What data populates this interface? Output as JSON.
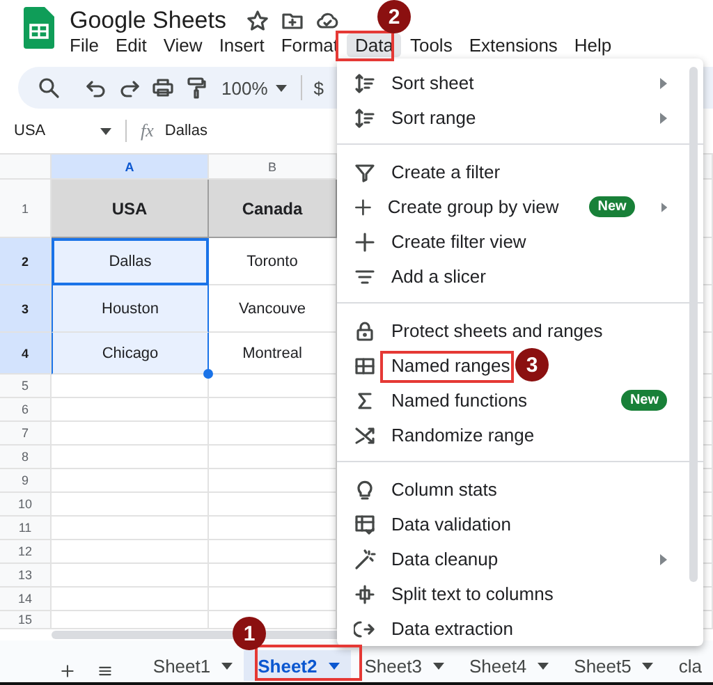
{
  "app": {
    "title": "Google Sheets"
  },
  "menu_bar": [
    {
      "label": "File",
      "selected": false
    },
    {
      "label": "Edit",
      "selected": false
    },
    {
      "label": "View",
      "selected": false
    },
    {
      "label": "Insert",
      "selected": false
    },
    {
      "label": "Format",
      "selected": false
    },
    {
      "label": "Data",
      "selected": true
    },
    {
      "label": "Tools",
      "selected": false
    },
    {
      "label": "Extensions",
      "selected": false
    },
    {
      "label": "Help",
      "selected": false
    }
  ],
  "toolbar": {
    "zoom": "100%",
    "currency": "$"
  },
  "formula_bar": {
    "name_box": "USA",
    "function_label": "fx",
    "formula": "Dallas"
  },
  "grid": {
    "columns": [
      {
        "label": "A",
        "selected": true
      },
      {
        "label": "B",
        "selected": false
      }
    ],
    "rows": [
      {
        "label": "1",
        "kind": "header",
        "selected": false,
        "cells": [
          {
            "text": "USA",
            "active": false
          },
          {
            "text": "Canada",
            "active": false
          }
        ]
      },
      {
        "label": "2",
        "kind": "data",
        "selected": true,
        "cells": [
          {
            "text": "Dallas",
            "active": true
          },
          {
            "text": "Toronto",
            "active": false
          }
        ]
      },
      {
        "label": "3",
        "kind": "data",
        "selected": true,
        "cells": [
          {
            "text": "Houston",
            "active": false
          },
          {
            "text": "Vancouve",
            "active": false
          }
        ]
      },
      {
        "label": "4",
        "kind": "data",
        "selected": true,
        "cells": [
          {
            "text": "Chicago",
            "active": false
          },
          {
            "text": "Montreal",
            "active": false
          }
        ]
      },
      {
        "label": "5",
        "kind": "empty",
        "selected": false
      },
      {
        "label": "6",
        "kind": "empty",
        "selected": false
      },
      {
        "label": "7",
        "kind": "empty",
        "selected": false
      },
      {
        "label": "8",
        "kind": "empty",
        "selected": false
      },
      {
        "label": "9",
        "kind": "empty",
        "selected": false
      },
      {
        "label": "10",
        "kind": "empty",
        "selected": false
      },
      {
        "label": "11",
        "kind": "empty",
        "selected": false
      },
      {
        "label": "12",
        "kind": "empty",
        "selected": false
      },
      {
        "label": "13",
        "kind": "empty",
        "selected": false
      },
      {
        "label": "14",
        "kind": "empty",
        "selected": false
      },
      {
        "label": "15",
        "kind": "empty",
        "selected": false
      }
    ]
  },
  "sheet_tabs": [
    {
      "label": "Sheet1",
      "selected": false,
      "caret": true
    },
    {
      "label": "Sheet2",
      "selected": true,
      "caret": true
    },
    {
      "label": "Sheet3",
      "selected": false,
      "caret": true
    },
    {
      "label": "Sheet4",
      "selected": false,
      "caret": true
    },
    {
      "label": "Sheet5",
      "selected": false,
      "caret": true
    },
    {
      "label": "cla",
      "selected": false,
      "caret": false
    }
  ],
  "data_menu": [
    {
      "kind": "item",
      "label": "Sort sheet",
      "submenu": true
    },
    {
      "kind": "item",
      "label": "Sort range",
      "submenu": true
    },
    {
      "kind": "divider"
    },
    {
      "kind": "item",
      "label": "Create a filter",
      "submenu": false
    },
    {
      "kind": "item",
      "label": "Create group by view",
      "badge": "New",
      "submenu": true
    },
    {
      "kind": "item",
      "label": "Create filter view",
      "submenu": false
    },
    {
      "kind": "item",
      "label": "Add a slicer",
      "submenu": false
    },
    {
      "kind": "divider"
    },
    {
      "kind": "item",
      "label": "Protect sheets and ranges",
      "submenu": false
    },
    {
      "kind": "item",
      "label": "Named ranges",
      "submenu": false
    },
    {
      "kind": "item",
      "label": "Named functions",
      "badge": "New",
      "submenu": false
    },
    {
      "kind": "item",
      "label": "Randomize range",
      "submenu": false
    },
    {
      "kind": "divider"
    },
    {
      "kind": "item",
      "label": "Column stats",
      "submenu": false
    },
    {
      "kind": "item",
      "label": "Data validation",
      "submenu": false
    },
    {
      "kind": "item",
      "label": "Data cleanup",
      "submenu": true
    },
    {
      "kind": "item",
      "label": "Split text to columns",
      "submenu": false
    },
    {
      "kind": "item",
      "label": "Data extraction",
      "submenu": false
    }
  ],
  "callouts": [
    {
      "number": "1"
    },
    {
      "number": "2"
    },
    {
      "number": "3"
    }
  ]
}
